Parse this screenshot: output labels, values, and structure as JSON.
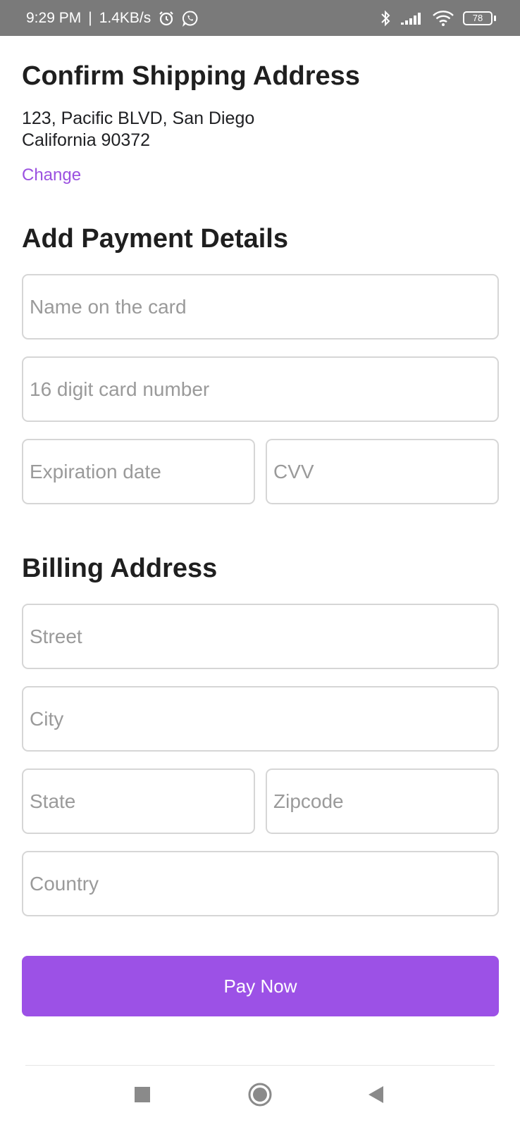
{
  "status_bar": {
    "time": "9:29 PM",
    "separator": "|",
    "network_speed": "1.4KB/s",
    "battery_level": "78",
    "icons": [
      "alarm-icon",
      "whatsapp-icon",
      "bluetooth-icon",
      "signal-icon",
      "wifi-icon",
      "battery-icon"
    ]
  },
  "shipping": {
    "title": "Confirm Shipping Address",
    "address_line1": "123, Pacific BLVD, San Diego",
    "address_line2": "California 90372",
    "change_label": "Change"
  },
  "payment": {
    "title": "Add Payment Details",
    "name_placeholder": "Name on the card",
    "card_number_placeholder": "16 digit card number",
    "expiration_placeholder": "Expiration date",
    "cvv_placeholder": "CVV"
  },
  "billing": {
    "title": "Billing Address",
    "street_placeholder": "Street",
    "city_placeholder": "City",
    "state_placeholder": "State",
    "zipcode_placeholder": "Zipcode",
    "country_placeholder": "Country"
  },
  "pay_button_label": "Pay Now",
  "nav_bar": {
    "icons": [
      "recents-square-icon",
      "home-circle-icon",
      "back-triangle-icon"
    ]
  },
  "colors": {
    "accent": "#9c51e6",
    "link": "#9b51e0",
    "status_bar": "#7a7a7a",
    "field_border": "#d6d6d6",
    "placeholder": "#9a9a9a"
  }
}
